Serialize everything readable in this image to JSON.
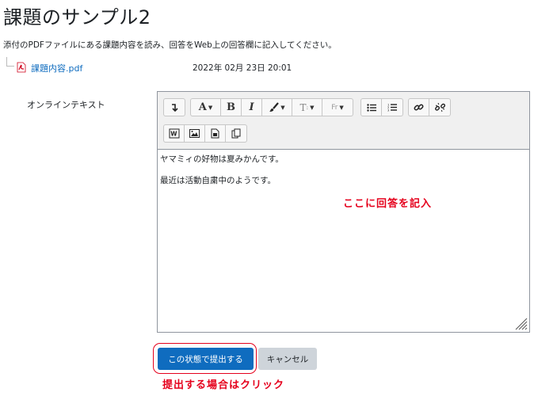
{
  "page": {
    "title": "課題のサンプル2",
    "intro": "添付のPDFファイルにある課題内容を読み、回答をWeb上の回答欄に記入してください。"
  },
  "attachment": {
    "filename": "課題内容.pdf",
    "date": "2022年 02月 23日 20:01"
  },
  "form": {
    "field_label": "オンラインテキスト"
  },
  "toolbar": {
    "icons": [
      "toggle-toolbar-icon",
      "font-color-icon",
      "bold-icon",
      "italic-icon",
      "paint-brush-icon",
      "text-style-icon",
      "font-family-icon",
      "bullet-list-icon",
      "numbered-list-icon",
      "link-icon",
      "unlink-icon",
      "word-paste-icon",
      "image-icon",
      "media-icon",
      "manage-files-icon"
    ],
    "bold_label": "B",
    "italic_label": "I",
    "font_color_label": "A",
    "text_style_label": "T",
    "font_family_label": "Fr"
  },
  "editor": {
    "paragraphs": [
      "ヤマミィの好物は夏みかんです。",
      "最近は活動自粛中のようです。"
    ]
  },
  "buttons": {
    "submit": "この状態で提出する",
    "cancel": "キャンセル"
  },
  "annotations": {
    "answer_here": "ここに回答を記入",
    "click_to_submit": "提出する場合はクリック"
  },
  "colors": {
    "primary": "#0f6cbf",
    "annotation": "#e5001c",
    "secondary_button": "#ced4da"
  }
}
